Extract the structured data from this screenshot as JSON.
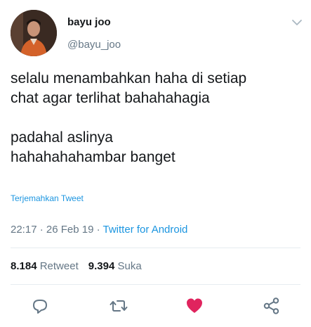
{
  "user": {
    "display_name": "bayu joo",
    "handle": "@bayu_joo"
  },
  "tweet": {
    "text": "selalu menambahkan haha di setiap\nchat agar terlihat bahahahagia\n\npadahal aslinya\nhahahahahambar banget",
    "translate_label": "Terjemahkan Tweet",
    "time": "22:17",
    "date": "26 Feb 19",
    "source": "Twitter for Android",
    "separator": " · "
  },
  "stats": {
    "retweets_count": "8.184",
    "retweets_label": "Retweet",
    "likes_count": "9.394",
    "likes_label": "Suka"
  },
  "icons": {
    "reply": "reply-icon",
    "retweet": "retweet-icon",
    "like": "heart-icon",
    "share": "share-icon",
    "caret": "chevron-down-icon"
  },
  "colors": {
    "like_active": "#e0245e",
    "link": "#1b95e0",
    "secondary_text": "#657786"
  }
}
